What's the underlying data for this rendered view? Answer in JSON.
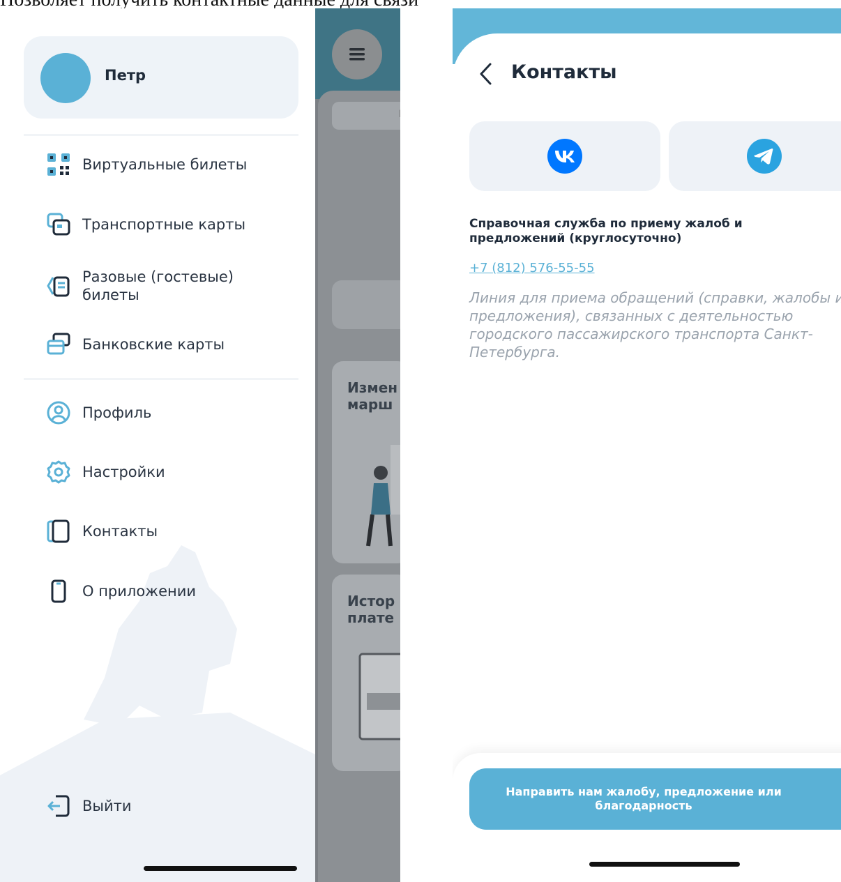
{
  "caption": "Позволяет получить контактные данные для связи",
  "drawer": {
    "user_name": "Петр",
    "menu_top": [
      {
        "label": "Виртуальные билеты",
        "icon": "qr-code-icon"
      },
      {
        "label": "Транспортные карты",
        "icon": "transport-cards-icon"
      },
      {
        "label": "Разовые (гостевые) билеты",
        "icon": "guest-ticket-icon"
      },
      {
        "label": "Банковские карты",
        "icon": "bank-cards-icon"
      }
    ],
    "menu_bottom": [
      {
        "label": "Профиль",
        "icon": "profile-icon"
      },
      {
        "label": "Настройки",
        "icon": "gear-icon"
      },
      {
        "label": "Контакты",
        "icon": "contacts-book-icon"
      },
      {
        "label": "О приложении",
        "icon": "phone-device-icon"
      }
    ],
    "logout_label": "Выйти"
  },
  "background_screen": {
    "tab_fragment": "Ви",
    "card1_title": "Измен\nмарш",
    "card2_title": "Истор\nплате"
  },
  "contacts": {
    "title": "Контакты",
    "social": [
      {
        "name": "VK",
        "icon": "vk-icon",
        "color": "#0077ff"
      },
      {
        "name": "Telegram",
        "icon": "telegram-icon",
        "color": "#2aa3e0"
      }
    ],
    "service_title": "Справочная служба по приему жалоб и предложений (круглосуточно)",
    "phone": "+7 (812) 576-55-55",
    "service_description": "Линия для приема обращений (справки, жалобы и предложения), связанных с деятельностью городского пассажирского транспорта Санкт-Петербурга.",
    "action_button": "Направить нам жалобу, предложение или благодарность"
  },
  "colors": {
    "accent": "#5ab1d6",
    "header_blue": "#62b6d8",
    "text_dark": "#1f2b3a",
    "text_muted": "#9aa3ad",
    "card_bg": "#eef2f7"
  }
}
